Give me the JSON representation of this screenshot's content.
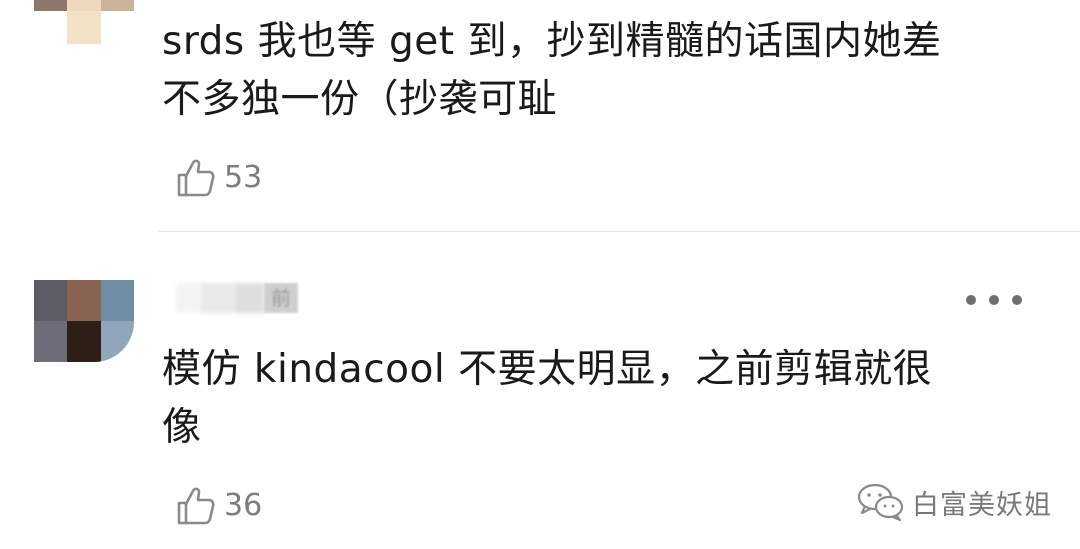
{
  "comments": [
    {
      "text_line1": "srds 我也等 get 到，抄到精髓的话国内她差",
      "text_line2": "不多独一份（抄袭可耻",
      "likes": "53"
    },
    {
      "username_visible_fragment": "前",
      "text_line1": "模仿 kindacool 不要太明显，之前剪辑就很",
      "text_line2": "像",
      "likes": "36"
    }
  ],
  "watermark": {
    "text": "白富美妖姐"
  },
  "icons": {
    "like": "thumb-up-icon",
    "more": "more-dots-icon",
    "watermark": "wechat-icon"
  },
  "colors": {
    "text": "#1a1a1a",
    "muted": "#7d7d7d",
    "divider": "#e6e6e6"
  }
}
